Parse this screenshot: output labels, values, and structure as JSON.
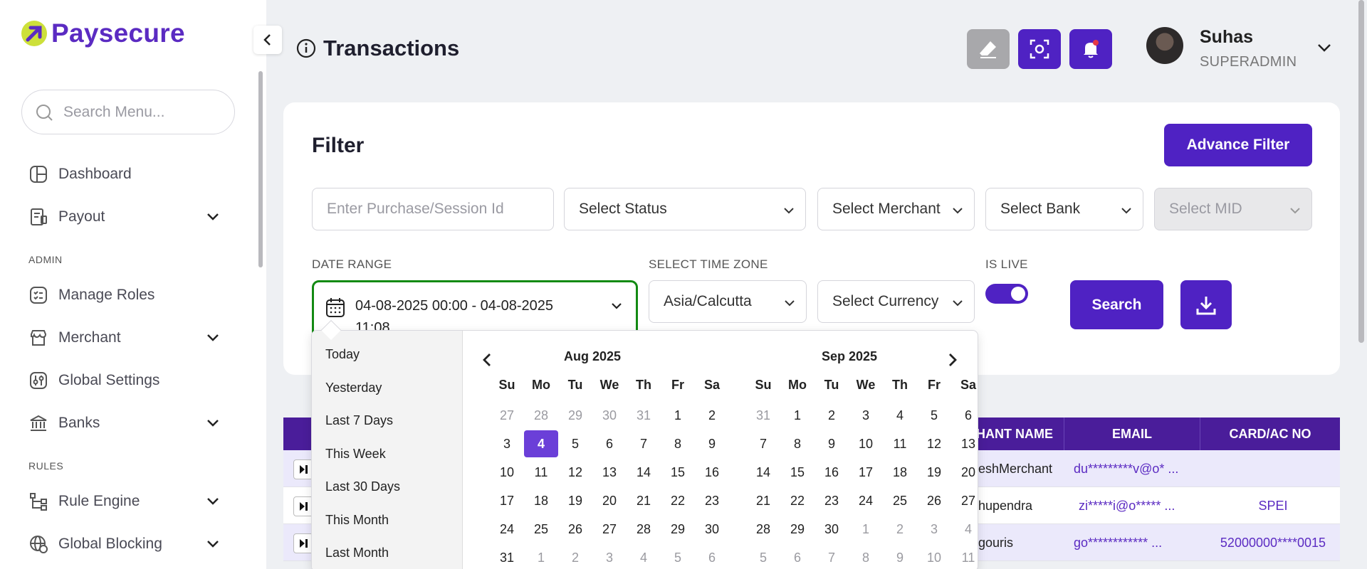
{
  "sidebar": {
    "brand": "Paysecure",
    "search_placeholder": "Search Menu...",
    "items": [
      {
        "label": "Dashboard"
      },
      {
        "label": "Payout"
      },
      {
        "label": "Manage Roles"
      },
      {
        "label": "Merchant"
      },
      {
        "label": "Global Settings"
      },
      {
        "label": "Banks"
      },
      {
        "label": "Rule Engine"
      },
      {
        "label": "Global Blocking"
      }
    ],
    "sections": [
      "ADMIN",
      "RULES"
    ]
  },
  "header": {
    "title": "Transactions",
    "user_name": "Suhas",
    "user_role": "SUPERADMIN"
  },
  "filter": {
    "title": "Filter",
    "advance_filter": "Advance Filter",
    "purchase_placeholder": "Enter Purchase/Session Id",
    "status": "Select Status",
    "merchant": "Select Merchant",
    "bank": "Select Bank",
    "mid": "Select MID",
    "date_range_label": "DATE RANGE",
    "date_range_value": "04-08-2025 00:00 - 04-08-2025 11:08",
    "timezone_label": "SELECT TIME ZONE",
    "timezone": "Asia/Calcutta",
    "currency": "Select Currency",
    "is_live_label": "IS LIVE",
    "is_live": true,
    "search": "Search"
  },
  "picker": {
    "ranges": [
      "Today",
      "Yesterday",
      "Last 7 Days",
      "This Week",
      "Last 30 Days",
      "This Month",
      "Last Month"
    ],
    "dow": [
      "Su",
      "Mo",
      "Tu",
      "We",
      "Th",
      "Fr",
      "Sa"
    ],
    "months": [
      {
        "title": "Aug 2025",
        "weeks": [
          [
            "27",
            "28",
            "29",
            "30",
            "31",
            "1",
            "2"
          ],
          [
            "3",
            "4",
            "5",
            "6",
            "7",
            "8",
            "9"
          ],
          [
            "10",
            "11",
            "12",
            "13",
            "14",
            "15",
            "16"
          ],
          [
            "17",
            "18",
            "19",
            "20",
            "21",
            "22",
            "23"
          ],
          [
            "24",
            "25",
            "26",
            "27",
            "28",
            "29",
            "30"
          ],
          [
            "31",
            "1",
            "2",
            "3",
            "4",
            "5",
            "6"
          ]
        ],
        "muted": [
          [
            0,
            0
          ],
          [
            0,
            1
          ],
          [
            0,
            2
          ],
          [
            0,
            3
          ],
          [
            0,
            4
          ],
          [
            5,
            1
          ],
          [
            5,
            2
          ],
          [
            5,
            3
          ],
          [
            5,
            4
          ],
          [
            5,
            5
          ],
          [
            5,
            6
          ]
        ],
        "selected": [
          1,
          1
        ]
      },
      {
        "title": "Sep 2025",
        "weeks": [
          [
            "31",
            "1",
            "2",
            "3",
            "4",
            "5",
            "6"
          ],
          [
            "7",
            "8",
            "9",
            "10",
            "11",
            "12",
            "13"
          ],
          [
            "14",
            "15",
            "16",
            "17",
            "18",
            "19",
            "20"
          ],
          [
            "21",
            "22",
            "23",
            "24",
            "25",
            "26",
            "27"
          ],
          [
            "28",
            "29",
            "30",
            "1",
            "2",
            "3",
            "4"
          ],
          [
            "5",
            "6",
            "7",
            "8",
            "9",
            "10",
            "11"
          ]
        ],
        "muted": [
          [
            0,
            0
          ],
          [
            4,
            3
          ],
          [
            4,
            4
          ],
          [
            4,
            5
          ],
          [
            4,
            6
          ],
          [
            5,
            0
          ],
          [
            5,
            1
          ],
          [
            5,
            2
          ],
          [
            5,
            3
          ],
          [
            5,
            4
          ],
          [
            5,
            5
          ],
          [
            5,
            6
          ]
        ],
        "selected": null
      }
    ]
  },
  "table": {
    "headers": [
      "HANT NAME",
      "EMAIL",
      "CARD/AC NO"
    ],
    "rows": [
      {
        "merchant": "eshMerchant",
        "email": "du*********v@o* ...",
        "card": ""
      },
      {
        "merchant": "hupendra",
        "email": "zi*****i@o***** ...",
        "card": "SPEI"
      },
      {
        "merchant": "gouris",
        "email": "go************ ...",
        "card": "52000000****0015"
      }
    ]
  },
  "colors": {
    "brand": "#4f22c3",
    "table_header": "#4a1d9a",
    "active_date_border": "#138a13",
    "selected_day": "#6b3fd8",
    "row_highlight": "#ebe9fb",
    "link_text": "#5b2bc2"
  }
}
